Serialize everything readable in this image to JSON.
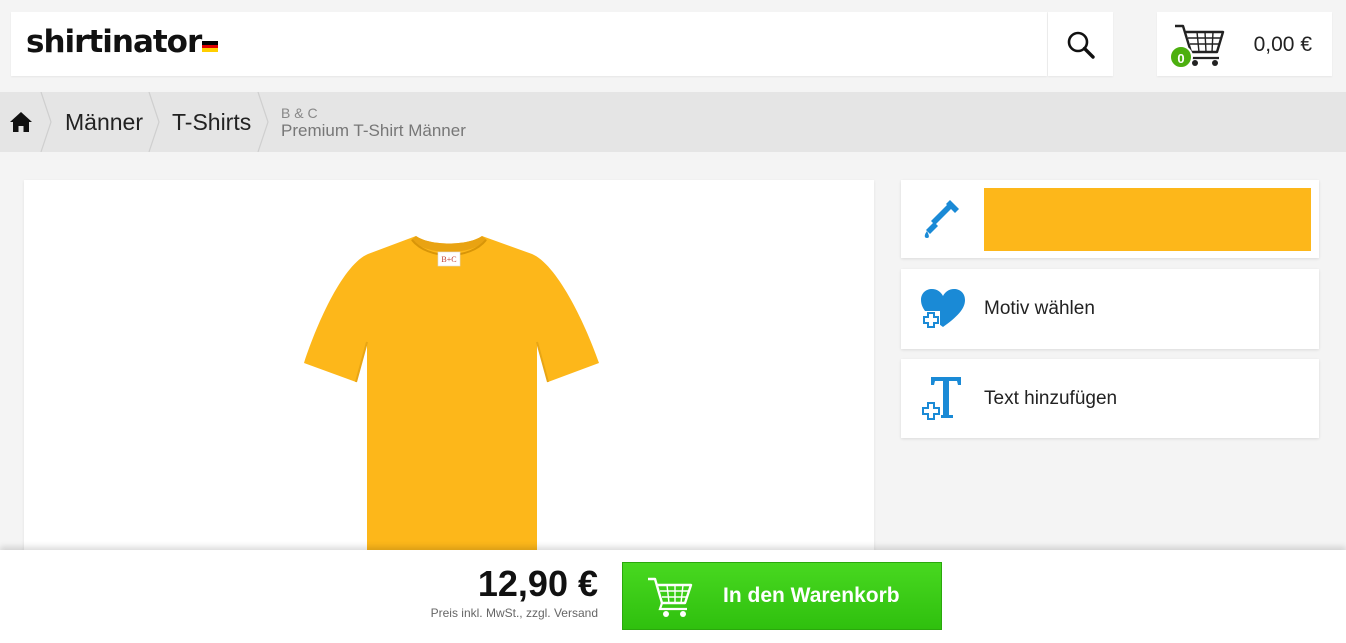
{
  "header": {
    "logo_text": "shirtinator",
    "flag_icon": "germany-flag-icon",
    "search_icon": "search-icon",
    "cart": {
      "icon": "shopping-cart-icon",
      "count": "0",
      "amount": "0,00 €"
    }
  },
  "breadcrumb": {
    "home_icon": "home-icon",
    "items": [
      {
        "label": "Männer"
      },
      {
        "label": "T-Shirts"
      }
    ],
    "current_brand": "B & C",
    "current_product": "Premium T-Shirt Männer"
  },
  "product": {
    "image": "yellow-tshirt-front",
    "color": "#fdb71a",
    "label_text": "B+C"
  },
  "options": {
    "color_icon": "color-dropper-icon",
    "selected_color": "#fdb71a",
    "motif_icon": "heart-plus-icon",
    "motif_label": "Motiv wählen",
    "text_icon": "text-plus-icon",
    "text_label": "Text hinzufügen"
  },
  "checkout": {
    "price": "12,90 €",
    "price_note": "Preis inkl. MwSt., zzgl. Versand",
    "button_label": "In den Warenkorb",
    "button_icon": "shopping-cart-icon"
  },
  "colors": {
    "accent_blue": "#1a8ad6",
    "cart_green": "#3ac812",
    "badge_green": "#4caf0f"
  }
}
